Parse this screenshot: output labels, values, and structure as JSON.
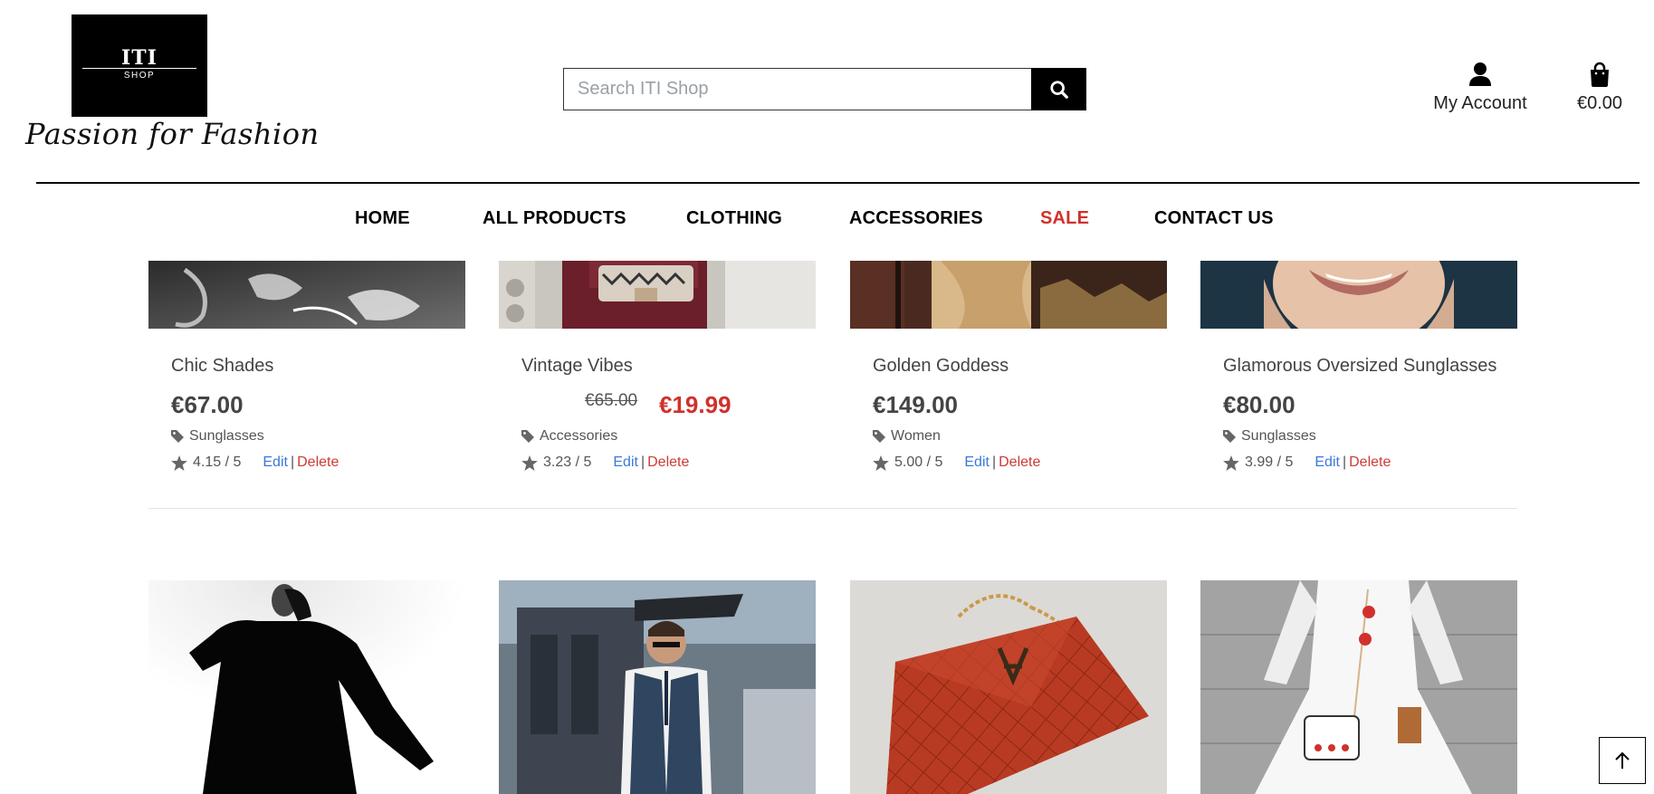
{
  "header": {
    "logo_main": "ITI",
    "logo_sub": "SHOP",
    "tagline": "Passion for Fashion",
    "search_placeholder": "Search ITI Shop",
    "account_label": "My Account",
    "cart_total": "€0.00"
  },
  "nav": {
    "items": [
      "HOME",
      "ALL PRODUCTS",
      "CLOTHING",
      "ACCESSORIES",
      "SALE",
      "CONTACT US"
    ]
  },
  "products": [
    {
      "name": "Chic Shades",
      "price": "€67.00",
      "category": "Sunglasses",
      "rating": "4.15 / 5",
      "edit": "Edit",
      "sep": "|",
      "delete": "Delete"
    },
    {
      "name": "Vintage Vibes",
      "old_price": "€65.00",
      "sale_price": "€19.99",
      "category": "Accessories",
      "rating": "3.23 / 5",
      "edit": "Edit",
      "sep": "|",
      "delete": "Delete"
    },
    {
      "name": "Golden Goddess",
      "price": "€149.00",
      "category": "Women",
      "rating": "5.00 / 5",
      "edit": "Edit",
      "sep": "|",
      "delete": "Delete"
    },
    {
      "name": "Glamorous Oversized Sunglasses",
      "price": "€80.00",
      "category": "Sunglasses",
      "rating": "3.99 / 5",
      "edit": "Edit",
      "sep": "|",
      "delete": "Delete"
    }
  ],
  "colors": {
    "sale": "#d0312d",
    "edit": "#3c78d8",
    "delete": "#cc3b34"
  },
  "icons": [
    "search-icon",
    "user-icon",
    "shopping-bag-icon",
    "tag-icon",
    "star-icon",
    "arrow-up-icon"
  ]
}
